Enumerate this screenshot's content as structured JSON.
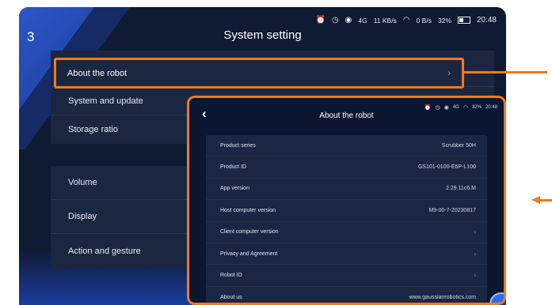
{
  "step_number": "3",
  "status_bar": {
    "icons": [
      "alarm-icon",
      "clock-icon",
      "location-icon"
    ],
    "signal": "4G",
    "net_speed_down": "11 KB/s",
    "net_speed_up": "0 B/s",
    "battery": "32%",
    "time": "20:48"
  },
  "page": {
    "title": "System setting"
  },
  "menu": {
    "about": "About the robot",
    "system_update": "System and update",
    "storage": "Storage ratio",
    "volume": "Volume",
    "display": "Display",
    "action_gesture": "Action and gesture"
  },
  "inset": {
    "title": "About the robot",
    "rows": [
      {
        "label": "Product series",
        "value": "Scrubber 50H"
      },
      {
        "label": "Product ID",
        "value": "GS101-0100-E6P-L100"
      },
      {
        "label": "App version",
        "value": "2.29.11c6.M"
      },
      {
        "label": "Host computer version",
        "value": "M9-00-7-20230817"
      },
      {
        "label": "Client computer version",
        "value": ""
      },
      {
        "label": "Privacy and Agreement",
        "value": ""
      },
      {
        "label": "Robot ID",
        "value": ""
      },
      {
        "label": "About us",
        "value": "www.gaussianrobotics.com"
      }
    ]
  },
  "colors": {
    "accent_orange": "#f07b1c",
    "panel_bg": "#0f1a33",
    "menu_bg": "#1b2740",
    "brand_blue": "#2b56c8"
  }
}
